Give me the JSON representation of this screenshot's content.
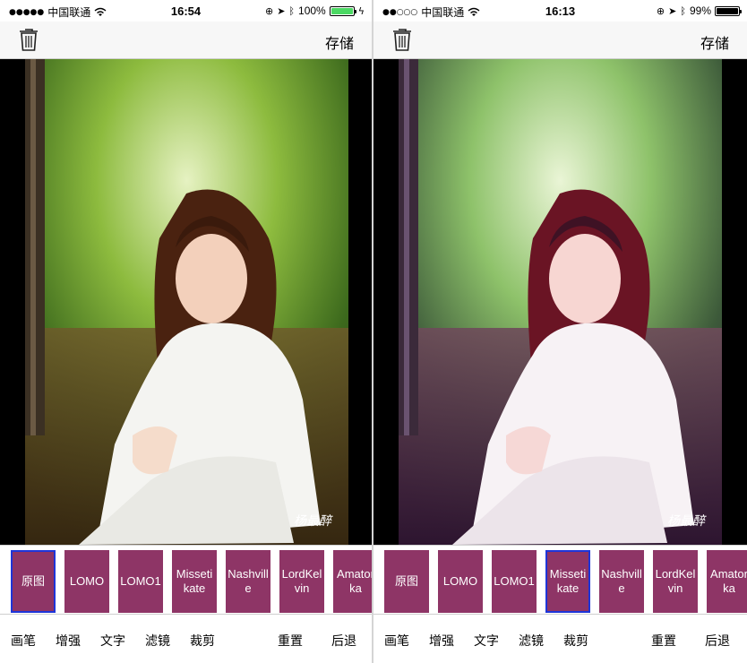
{
  "panels": [
    {
      "status": {
        "signal": "●●●●●",
        "carrier": "中国联通",
        "time": "16:54",
        "battery_text": "100%",
        "battery_level": 1.0,
        "battery_color": "#4cd964",
        "charging": true
      },
      "nav": {
        "save_label": "存储"
      },
      "filters": [
        {
          "label": "原图",
          "selected": true
        },
        {
          "label": "LOMO",
          "selected": false
        },
        {
          "label": "LOMO1",
          "selected": false
        },
        {
          "label": "Missetikate",
          "selected": false
        },
        {
          "label": "Nashville",
          "selected": false
        },
        {
          "label": "LordKelvin",
          "selected": false
        },
        {
          "label": "Amatorka",
          "selected": false
        }
      ],
      "toolbar": [
        "画笔",
        "增强",
        "文字",
        "滤镜",
        "裁剪",
        "重置",
        "后退"
      ],
      "photo_tone": "original"
    },
    {
      "status": {
        "signal": "●●○○○",
        "carrier": "中国联通",
        "time": "16:13",
        "battery_text": "99%",
        "battery_level": 0.99,
        "battery_color": "#000000",
        "charging": false
      },
      "nav": {
        "save_label": "存储"
      },
      "filters": [
        {
          "label": "原图",
          "selected": false
        },
        {
          "label": "LOMO",
          "selected": false
        },
        {
          "label": "LOMO1",
          "selected": false
        },
        {
          "label": "Missetikate",
          "selected": true
        },
        {
          "label": "Nashville",
          "selected": false
        },
        {
          "label": "LordKelvin",
          "selected": false
        },
        {
          "label": "Amatorka",
          "selected": false
        }
      ],
      "toolbar": [
        "画笔",
        "增强",
        "文字",
        "滤镜",
        "裁剪",
        "重置",
        "后退"
      ],
      "photo_tone": "missetikate"
    }
  ],
  "colors": {
    "filter_bg": "#8e3566",
    "selected_border": "#1e35d8",
    "nav_bg": "#f7f7f7"
  }
}
